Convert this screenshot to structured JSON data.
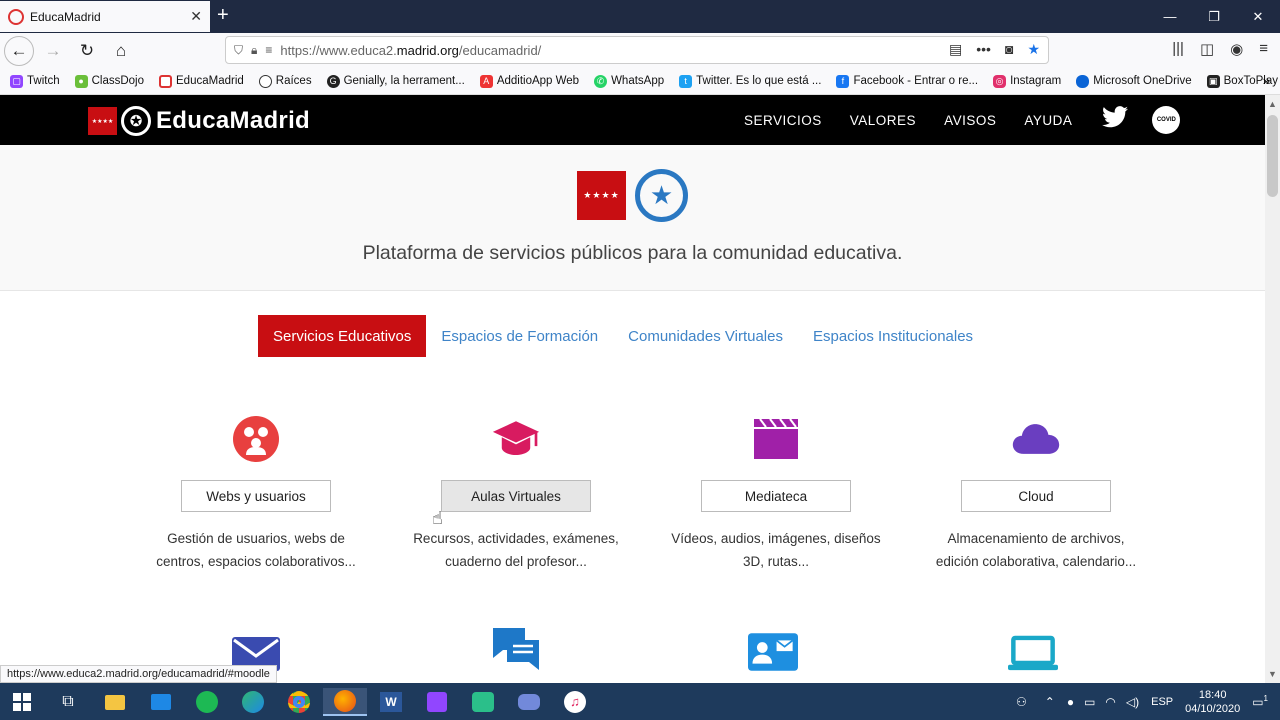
{
  "browser": {
    "tab_title": "EducaMadrid",
    "url_prefix": "https://www.educa2.",
    "url_domain": "madrid.org",
    "url_path": "/educamadrid/",
    "bookmarks": [
      "Twitch",
      "ClassDojo",
      "EducaMadrid",
      "Raíces",
      "Genially, la herrament...",
      "AdditioApp Web",
      "WhatsApp",
      "Twitter. Es lo que está ...",
      "Facebook - Entrar o re...",
      "Instagram",
      "Microsoft OneDrive",
      "BoxToPlay"
    ],
    "status_url": "https://www.educa2.madrid.org/educamadrid/#moodle"
  },
  "site": {
    "logo_text": "EducaMadrid",
    "menu": [
      "SERVICIOS",
      "VALORES",
      "AVISOS",
      "AYUDA"
    ],
    "tagline": "Plataforma de servicios públicos para la comunidad educativa.",
    "tabs": [
      "Servicios Educativos",
      "Espacios de Formación",
      "Comunidades Virtuales",
      "Espacios Institucionales"
    ],
    "active_tab": "Servicios Educativos",
    "cards": [
      {
        "label": "Webs y usuarios",
        "desc1": "Gestión de usuarios, webs de",
        "desc2": "centros, espacios colaborativos...",
        "icon": "users-icon",
        "color": "#e8403f"
      },
      {
        "label": "Aulas Virtuales",
        "desc1": "Recursos, actividades, exámenes,",
        "desc2": "cuaderno del profesor...",
        "icon": "graduation-cap-icon",
        "color": "#d81b60"
      },
      {
        "label": "Mediateca",
        "desc1": "Vídeos, audios, imágenes, diseños",
        "desc2": "3D, rutas...",
        "icon": "clapperboard-icon",
        "color": "#a020a8"
      },
      {
        "label": "Cloud",
        "desc1": "Almacenamiento de archivos,",
        "desc2": "edición colaborativa, calendario...",
        "icon": "cloud-icon",
        "color": "#6a3ec0"
      }
    ],
    "row2_icons": [
      {
        "icon": "mail-icon",
        "color": "#3a4bb0"
      },
      {
        "icon": "chat-icon",
        "color": "#1e78c8"
      },
      {
        "icon": "contact-card-icon",
        "color": "#1e8fe0"
      },
      {
        "icon": "laptop-icon",
        "color": "#1aa8c8"
      }
    ]
  },
  "taskbar": {
    "lang": "ESP",
    "time": "18:40",
    "date": "04/10/2020",
    "notifications": "1"
  }
}
